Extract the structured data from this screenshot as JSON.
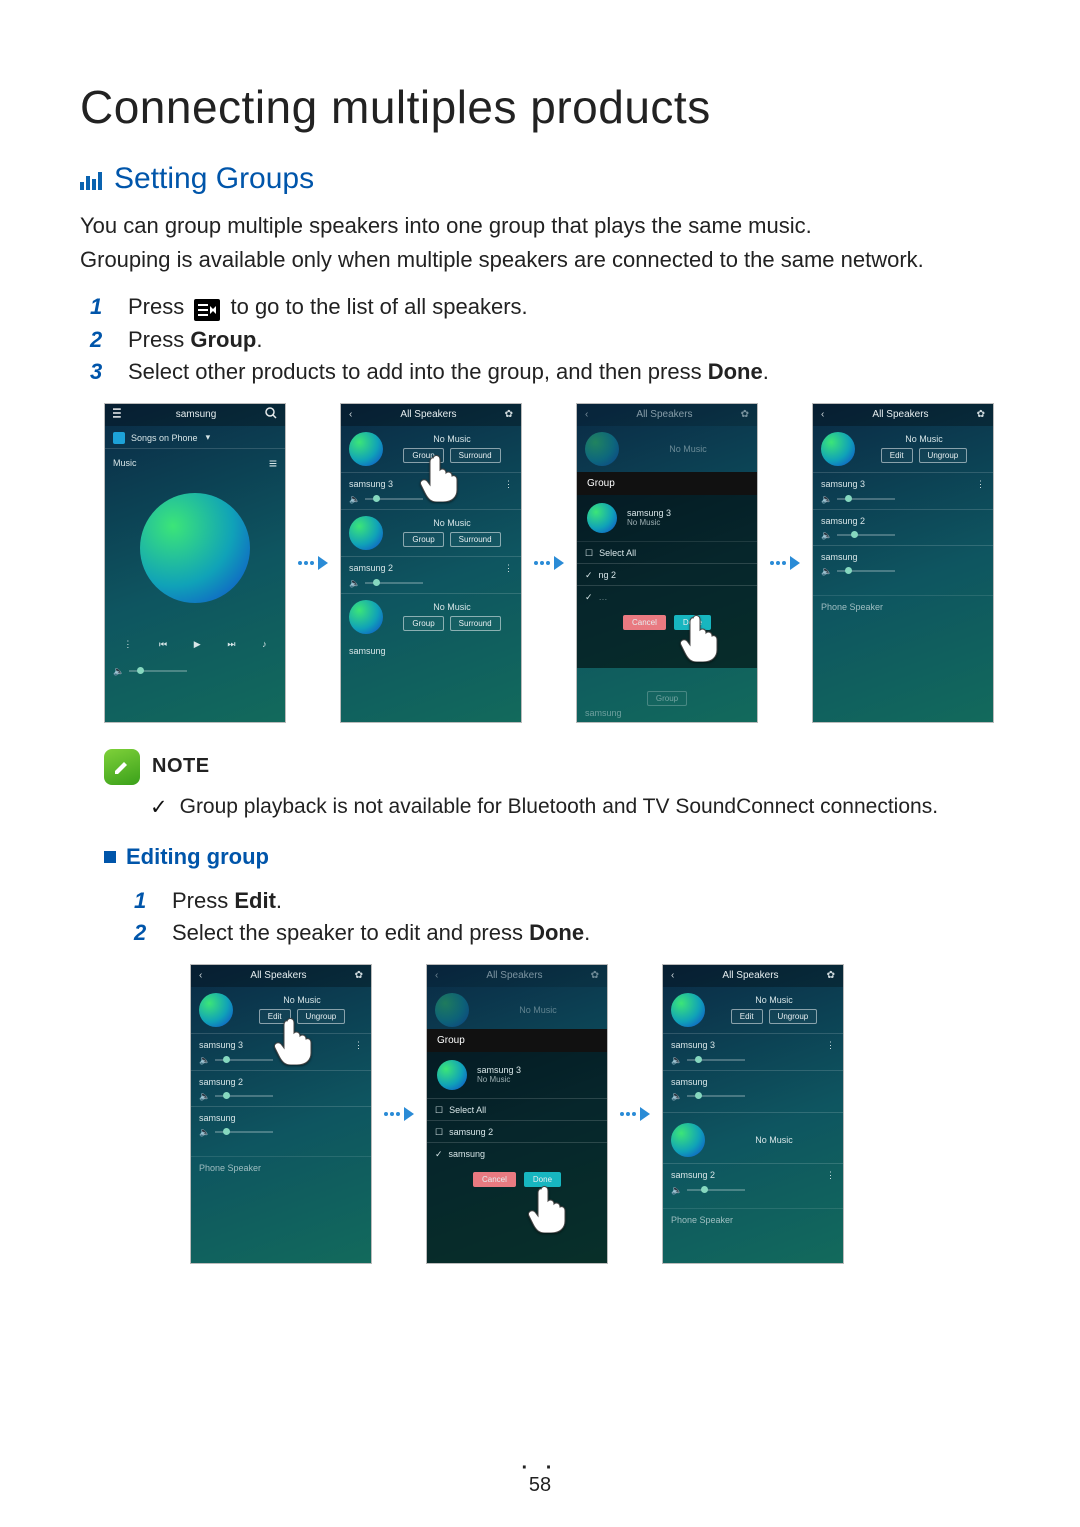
{
  "page": {
    "title": "Connecting multiples products",
    "number": "58"
  },
  "section": {
    "heading": "Setting Groups",
    "intro1": "You can group multiple speakers into one group that plays the same music.",
    "intro2": "Grouping is available only when multiple speakers are connected to the same network."
  },
  "steps_main": {
    "s1_a": "Press ",
    "s1_b": " to go to the list of all speakers.",
    "s2_a": "Press ",
    "s2_b": "Group",
    "s2_c": ".",
    "s3_a": "Select other products to add into the group, and then press ",
    "s3_b": "Done",
    "s3_c": "."
  },
  "note": {
    "label": "NOTE",
    "text": "Group playback is not available for Bluetooth and TV SoundConnect connections."
  },
  "editing": {
    "heading": "Editing group",
    "s1_a": "Press ",
    "s1_b": "Edit",
    "s1_c": ".",
    "s2_a": "Select the speaker to edit and press ",
    "s2_b": "Done",
    "s2_c": "."
  },
  "ui": {
    "no_music": "No Music",
    "all_speakers": "All Speakers",
    "phone_speaker": "Phone Speaker",
    "songs_on_phone": "Songs on Phone",
    "music": "Music",
    "samsung": "samsung",
    "group": "Group",
    "surround": "Surround",
    "edit": "Edit",
    "ungroup": "Ungroup",
    "select_all": "Select All",
    "cancel": "Cancel",
    "done": "Done",
    "speakers": {
      "s1": "samsung",
      "s2": "samsung 2",
      "s3": "samsung 3",
      "sng2_short": "ng 2"
    }
  }
}
